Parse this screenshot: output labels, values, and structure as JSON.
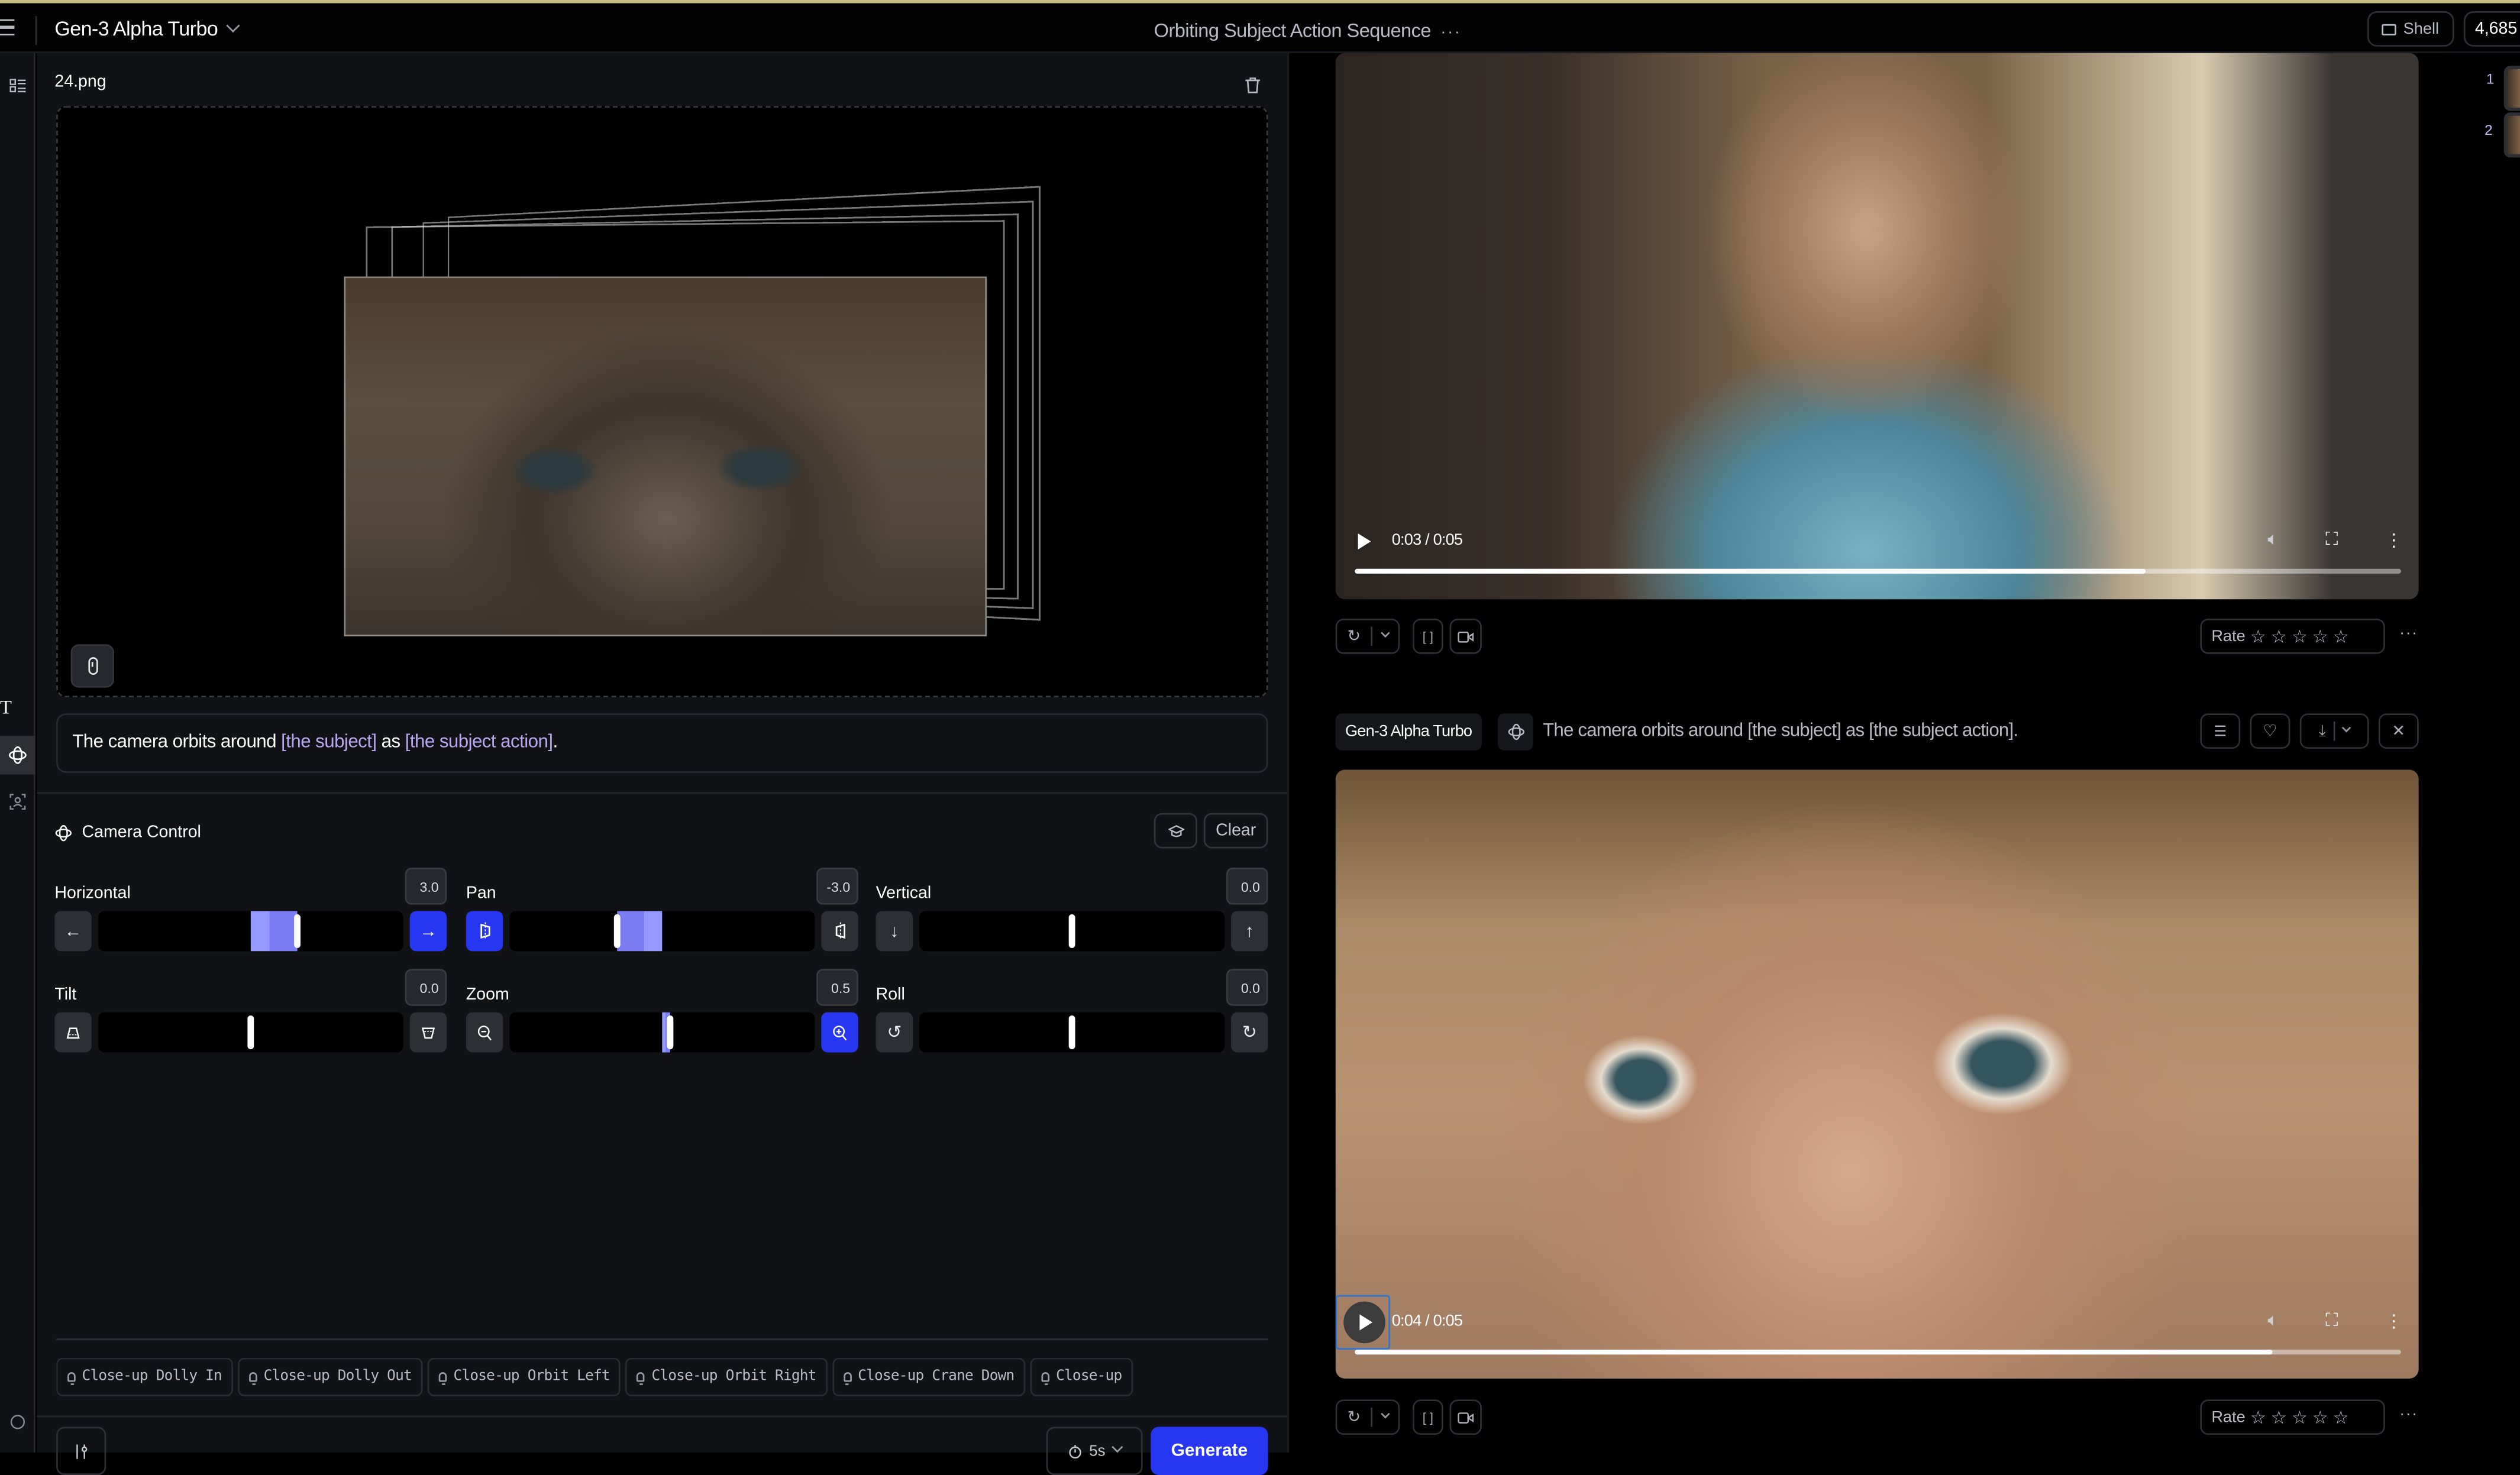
{
  "topbar": {
    "model_name": "Gen-3 Alpha Turbo",
    "project_title": "Orbiting Subject Action Sequence",
    "more_label": "···",
    "shell_label": "Shell",
    "credits": "4,685"
  },
  "rail": {
    "items": [
      "assets-icon",
      "text-icon",
      "camera-control-icon",
      "face-icon",
      "history-icon"
    ]
  },
  "input": {
    "file_name": "24.png",
    "prompt_parts": {
      "p1": "The camera orbits around ",
      "h1": "[the subject]",
      "p2": " as ",
      "h2": "[the subject action]",
      "p3": "."
    }
  },
  "camera_control": {
    "title": "Camera Control",
    "clear_label": "Clear",
    "controls": [
      {
        "name": "Horizontal",
        "value": "3.0",
        "numeric": 3.0,
        "active_side": "right"
      },
      {
        "name": "Pan",
        "value": "-3.0",
        "numeric": -3.0,
        "active_side": "left"
      },
      {
        "name": "Vertical",
        "value": "0.0",
        "numeric": 0.0,
        "active_side": "none"
      },
      {
        "name": "Tilt",
        "value": "0.0",
        "numeric": 0.0,
        "active_side": "none"
      },
      {
        "name": "Zoom",
        "value": "0.5",
        "numeric": 0.5,
        "active_side": "right"
      },
      {
        "name": "Roll",
        "value": "0.0",
        "numeric": 0.0,
        "active_side": "none"
      }
    ],
    "range": [
      -10,
      10
    ]
  },
  "presets": [
    "Close-up Dolly In",
    "Close-up Dolly Out",
    "Close-up Orbit Left",
    "Close-up Orbit Right",
    "Close-up Crane Down",
    "Close-up"
  ],
  "footer": {
    "duration": "5s",
    "generate_label": "Generate"
  },
  "outputs": [
    {
      "time": "0:03 / 0:05",
      "progress": 0.755,
      "rate_label": "Rate"
    },
    {
      "model": "Gen-3 Alpha Turbo",
      "prompt": "The camera orbits around [the subject] as [the subject action].",
      "time": "0:04 / 0:05",
      "progress": 0.877,
      "rate_label": "Rate"
    }
  ],
  "thumbnails": [
    {
      "index": "1"
    },
    {
      "index": "2"
    }
  ],
  "colors": {
    "accent": "#2736f0",
    "highlight_text": "#b9a8f0",
    "slider_fill": "#7a7ef2",
    "topbar_border": "#c9bd86"
  }
}
